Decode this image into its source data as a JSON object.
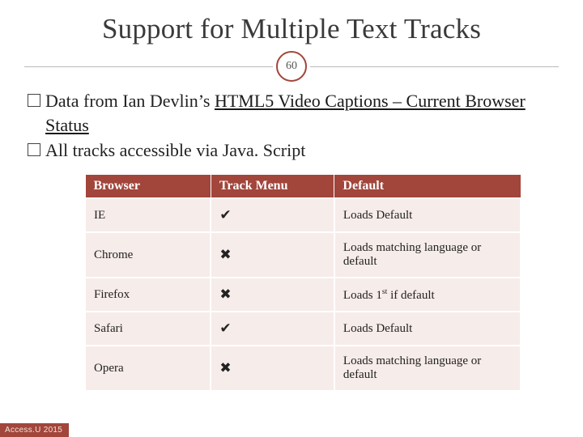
{
  "page_number": "60",
  "title": "Support for Multiple Text Tracks",
  "bullets": [
    {
      "prefix": "Data from Ian Devlin’s ",
      "link": "HTML5 Video Captions – Current Browser Status",
      "suffix": ""
    },
    {
      "prefix": "All tracks accessible via Java. Script",
      "link": "",
      "suffix": ""
    }
  ],
  "table": {
    "headers": {
      "browser": "Browser",
      "track_menu": "Track Menu",
      "default": "Default"
    },
    "rows": [
      {
        "browser": "IE",
        "track_menu": "✔",
        "default": "Loads Default"
      },
      {
        "browser": "Chrome",
        "track_menu": "✖",
        "default": "Loads matching language or default"
      },
      {
        "browser": "Firefox",
        "track_menu": "✖",
        "default_html": "Loads 1<span class=\"sup\">st</span> if default"
      },
      {
        "browser": "Safari",
        "track_menu": "✔",
        "default": "Loads Default"
      },
      {
        "browser": "Opera",
        "track_menu": "✖",
        "default": "Loads matching language or default"
      }
    ]
  },
  "footer": "Access.U 2015"
}
